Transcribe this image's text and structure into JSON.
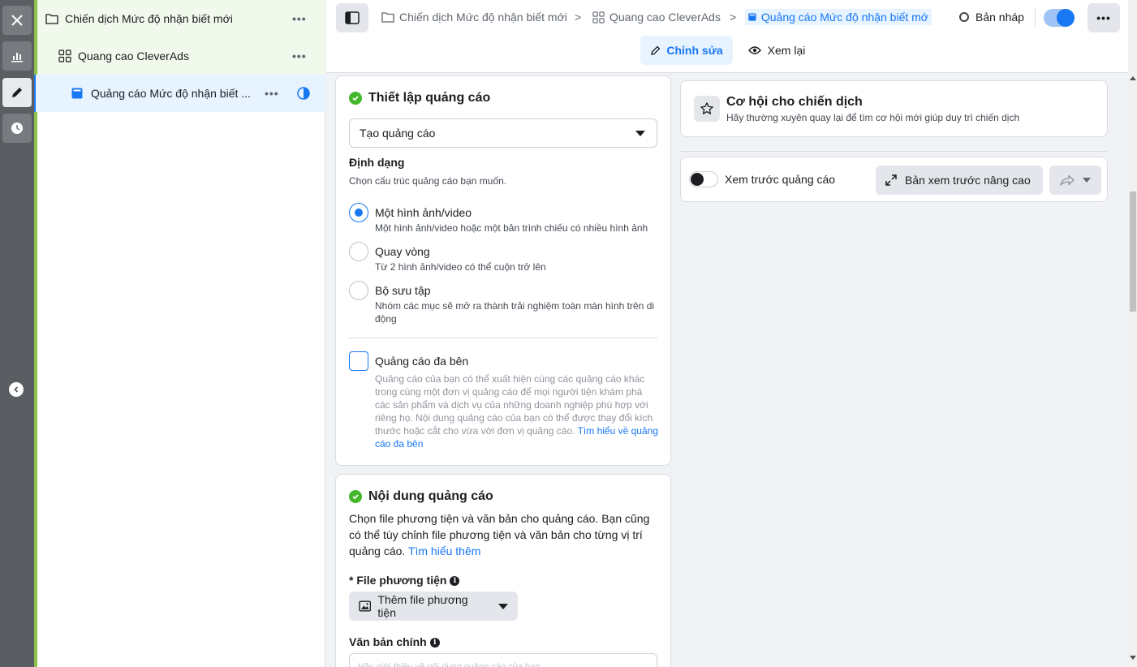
{
  "tree": {
    "campaign": "Chiến dịch Mức độ nhận biết mới",
    "adset": "Quang cao CleverAds",
    "ad": "Quảng cáo Mức độ nhận biết ...",
    "more": "•••"
  },
  "header": {
    "crumbs": [
      "Chiến dịch Mức độ nhận biết mới",
      "Quang cao CleverAds",
      "Quảng cáo Mức độ nhận biết mớ"
    ],
    "status": "Bản nháp",
    "more": "•••",
    "tab_edit": "Chỉnh sửa",
    "tab_review": "Xem lại"
  },
  "setup": {
    "title": "Thiết lập quảng cáo",
    "select_value": "Tạo quảng cáo",
    "format_heading": "Định dạng",
    "format_help": "Chọn cấu trúc quảng cáo bạn muốn.",
    "options": [
      {
        "title": "Một hình ảnh/video",
        "desc": "Một hình ảnh/video hoặc một bản trình chiếu có nhiều hình ảnh",
        "selected": true
      },
      {
        "title": "Quay vòng",
        "desc": "Từ 2 hình ảnh/video có thể cuộn trở lên",
        "selected": false
      },
      {
        "title": "Bộ sưu tập",
        "desc": "Nhóm các mục sẽ mở ra thành trải nghiệm toàn màn hình trên di động",
        "selected": false
      }
    ],
    "multi_title": "Quảng cáo đa bên",
    "multi_desc": "Quảng cáo của bạn có thể xuất hiện cùng các quảng cáo khác trong cùng một đơn vị quảng cáo để mọi người tiện khám phá các sản phẩm và dịch vụ của những doanh nghiệp phù hợp với riêng họ. Nội dung quảng cáo của bạn có thể được thay đổi kích thước hoặc cắt cho vừa với đơn vị quảng cáo.",
    "multi_link": "Tìm hiểu về quảng cáo đa bên"
  },
  "content": {
    "title": "Nội dung quảng cáo",
    "desc": "Chọn file phương tiện và văn bản cho quảng cáo. Bạn cũng có thể tùy chỉnh file phương tiện và văn bản cho từng vị trí quảng cáo.",
    "desc_link": "Tìm hiểu thêm",
    "media_label": "* File phương tiện",
    "media_button": "Thêm file phương tiện",
    "primary_label": "Văn bản chính",
    "primary_placeholder": "Hãy giới thiệu về nội dung quảng cáo của bạn"
  },
  "opportunity": {
    "title": "Cơ hội cho chiến dịch",
    "subtitle": "Hãy thường xuyên quay lại để tìm cơ hội mới giúp duy trì chiến dịch"
  },
  "preview": {
    "label": "Xem trước quảng cáo",
    "advanced": "Bản xem trước nâng cao"
  },
  "colors": {
    "accent": "#1877f2",
    "success": "#42b72a",
    "rail": "#5a5d61"
  }
}
